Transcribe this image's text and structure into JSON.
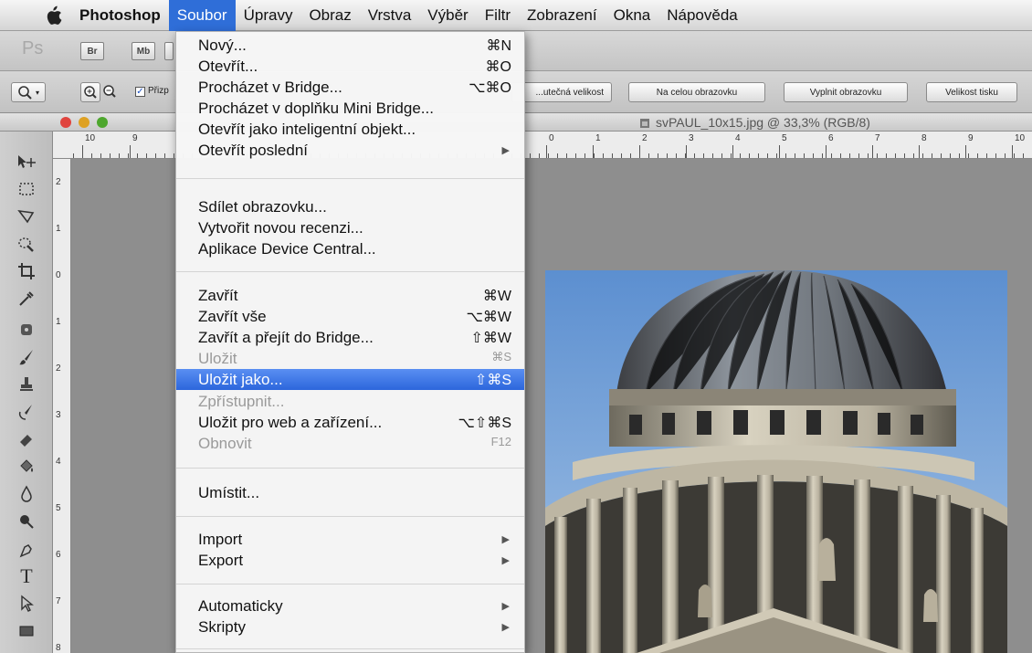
{
  "menubar": {
    "apple_icon": "apple-icon",
    "items": [
      "Photoshop",
      "Soubor",
      "Úpravy",
      "Obraz",
      "Vrstva",
      "Výběr",
      "Filtr",
      "Zobrazení",
      "Okna",
      "Nápověda"
    ],
    "active_item": "Soubor"
  },
  "app_bar": {
    "logo": "Ps",
    "bridge_button": "Br",
    "minibridge_button": "Mb"
  },
  "options_bar": {
    "checkbox_label": "Přizp",
    "buttons": [
      "...utečná velikost",
      "Na celou obrazovku",
      "Vyplnit obrazovku",
      "Velikost tisku"
    ]
  },
  "document": {
    "title": "svPAUL_10x15.jpg @ 33,3% (RGB/8)"
  },
  "rulers": {
    "h_left": [
      "10",
      "9"
    ],
    "h_right": [
      "0",
      "1",
      "2",
      "3",
      "4",
      "5",
      "6",
      "7",
      "8",
      "9",
      "10"
    ],
    "v": [
      "2",
      "1",
      "0",
      "1",
      "2",
      "3",
      "4",
      "5",
      "6",
      "7",
      "8"
    ]
  },
  "file_menu": {
    "items": [
      {
        "label": "Nový...",
        "shortcut": "⌘N"
      },
      {
        "label": "Otevřít...",
        "shortcut": "⌘O"
      },
      {
        "label": "Procházet v Bridge...",
        "shortcut": "⌥⌘O"
      },
      {
        "label": "Procházet v doplňku Mini Bridge...",
        "shortcut": ""
      },
      {
        "label": "Otevřít jako inteligentní objekt...",
        "shortcut": ""
      },
      {
        "label": "Otevřít poslední",
        "shortcut": "",
        "submenu": true
      },
      {
        "label": "Sdílet obrazovku...",
        "shortcut": ""
      },
      {
        "label": "Vytvořit novou recenzi...",
        "shortcut": ""
      },
      {
        "label": "Aplikace Device Central...",
        "shortcut": ""
      },
      {
        "label": "Zavřít",
        "shortcut": "⌘W"
      },
      {
        "label": "Zavřít vše",
        "shortcut": "⌥⌘W"
      },
      {
        "label": "Zavřít a přejít do Bridge...",
        "shortcut": "⇧⌘W"
      },
      {
        "label": "Uložit",
        "shortcut": "⌘S",
        "disabled": true
      },
      {
        "label": "Uložit jako...",
        "shortcut": "⇧⌘S",
        "highlighted": true
      },
      {
        "label": "Zpřístupnit...",
        "shortcut": "",
        "disabled": true
      },
      {
        "label": "Uložit pro web a zařízení...",
        "shortcut": "⌥⇧⌘S"
      },
      {
        "label": "Obnovit",
        "shortcut": "F12",
        "disabled": true
      },
      {
        "label": "Umístit...",
        "shortcut": ""
      },
      {
        "label": "Import",
        "shortcut": "",
        "submenu": true
      },
      {
        "label": "Export",
        "shortcut": "",
        "submenu": true
      },
      {
        "label": "Automaticky",
        "shortcut": "",
        "submenu": true
      },
      {
        "label": "Skripty",
        "shortcut": "",
        "submenu": true
      }
    ]
  },
  "colors": {
    "highlight": "#2c66dc",
    "menubar_active": "#2f6ed8"
  }
}
